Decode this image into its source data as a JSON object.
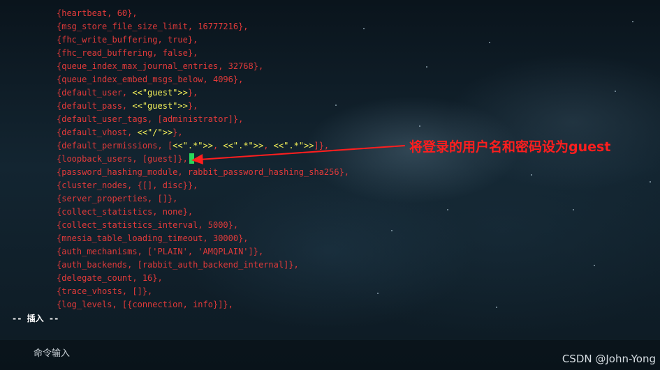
{
  "editor": {
    "lines": [
      {
        "name": "line-heartbeat",
        "parts": [
          {
            "t": "{heartbeat, 60},",
            "c": "r"
          }
        ]
      },
      {
        "name": "line-msg-store-file-size-limit",
        "parts": [
          {
            "t": "{msg_store_file_size_limit, 16777216},",
            "c": "r"
          }
        ]
      },
      {
        "name": "line-fhc-write-buffering",
        "parts": [
          {
            "t": "{fhc_write_buffering, true},",
            "c": "r"
          }
        ]
      },
      {
        "name": "line-fhc-read-buffering",
        "parts": [
          {
            "t": "{fhc_read_buffering, false},",
            "c": "r"
          }
        ]
      },
      {
        "name": "line-queue-index-max-journal-entries",
        "parts": [
          {
            "t": "{queue_index_max_journal_entries, 32768},",
            "c": "r"
          }
        ]
      },
      {
        "name": "line-queue-index-embed-msgs-below",
        "parts": [
          {
            "t": "{queue_index_embed_msgs_below, 4096},",
            "c": "r"
          }
        ]
      },
      {
        "name": "line-default-user",
        "parts": [
          {
            "t": "{default_user, ",
            "c": "r"
          },
          {
            "t": "<<\"guest\">>",
            "c": "y"
          },
          {
            "t": "},",
            "c": "r"
          }
        ]
      },
      {
        "name": "line-default-pass",
        "parts": [
          {
            "t": "{default_pass, ",
            "c": "r"
          },
          {
            "t": "<<\"guest\">>",
            "c": "y"
          },
          {
            "t": "},",
            "c": "r"
          }
        ]
      },
      {
        "name": "line-default-user-tags",
        "parts": [
          {
            "t": "{default_user_tags, [administrator]},",
            "c": "r"
          }
        ]
      },
      {
        "name": "line-default-vhost",
        "parts": [
          {
            "t": "{default_vhost, ",
            "c": "r"
          },
          {
            "t": "<<\"/\">>",
            "c": "y"
          },
          {
            "t": "},",
            "c": "r"
          }
        ]
      },
      {
        "name": "line-default-permissions",
        "parts": [
          {
            "t": "{default_permissions, [",
            "c": "r"
          },
          {
            "t": "<<\".*\">>",
            "c": "y"
          },
          {
            "t": ", ",
            "c": "r"
          },
          {
            "t": "<<\".*\">>",
            "c": "y"
          },
          {
            "t": ", ",
            "c": "r"
          },
          {
            "t": "<<\".*\">>",
            "c": "y"
          },
          {
            "t": "]},",
            "c": "r"
          }
        ]
      },
      {
        "name": "line-loopback-users",
        "cursor": true,
        "parts": [
          {
            "t": "{loopback_users, [guest]},",
            "c": "r"
          }
        ]
      },
      {
        "name": "line-password-hashing-module",
        "parts": [
          {
            "t": "{password_hashing_module, rabbit_password_hashing_sha256},",
            "c": "r"
          }
        ]
      },
      {
        "name": "line-cluster-nodes",
        "parts": [
          {
            "t": "{cluster_nodes, {[], disc}},",
            "c": "r"
          }
        ]
      },
      {
        "name": "line-server-properties",
        "parts": [
          {
            "t": "{server_properties, []},",
            "c": "r"
          }
        ]
      },
      {
        "name": "line-collect-statistics",
        "parts": [
          {
            "t": "{collect_statistics, none},",
            "c": "r"
          }
        ]
      },
      {
        "name": "line-collect-statistics-interval",
        "parts": [
          {
            "t": "{collect_statistics_interval, 5000},",
            "c": "r"
          }
        ]
      },
      {
        "name": "line-mnesia-table-loading-timeout",
        "parts": [
          {
            "t": "{mnesia_table_loading_timeout, 30000},",
            "c": "r"
          }
        ]
      },
      {
        "name": "line-auth-mechanisms",
        "parts": [
          {
            "t": "{auth_mechanisms, ['PLAIN', 'AMQPLAIN']},",
            "c": "r"
          }
        ]
      },
      {
        "name": "line-auth-backends",
        "parts": [
          {
            "t": "{auth_backends, [rabbit_auth_backend_internal]},",
            "c": "r"
          }
        ]
      },
      {
        "name": "line-delegate-count",
        "parts": [
          {
            "t": "{delegate_count, 16},",
            "c": "r"
          }
        ]
      },
      {
        "name": "line-trace-vhosts",
        "parts": [
          {
            "t": "{trace_vhosts, []},",
            "c": "r"
          }
        ]
      },
      {
        "name": "line-log-levels",
        "parts": [
          {
            "t": "{log_levels, [{connection, info}]},",
            "c": "r"
          }
        ]
      }
    ],
    "mode_indicator": "-- 插入 --",
    "colors": {
      "r": "#e23a3a",
      "y": "#f7f35a",
      "cursor": "#29d65a"
    }
  },
  "command_bar": {
    "label": "命令输入"
  },
  "annotation": {
    "text": "将登录的用户名和密码设为guest",
    "color": "#ff1e1e"
  },
  "watermark": "CSDN @John-Yong"
}
